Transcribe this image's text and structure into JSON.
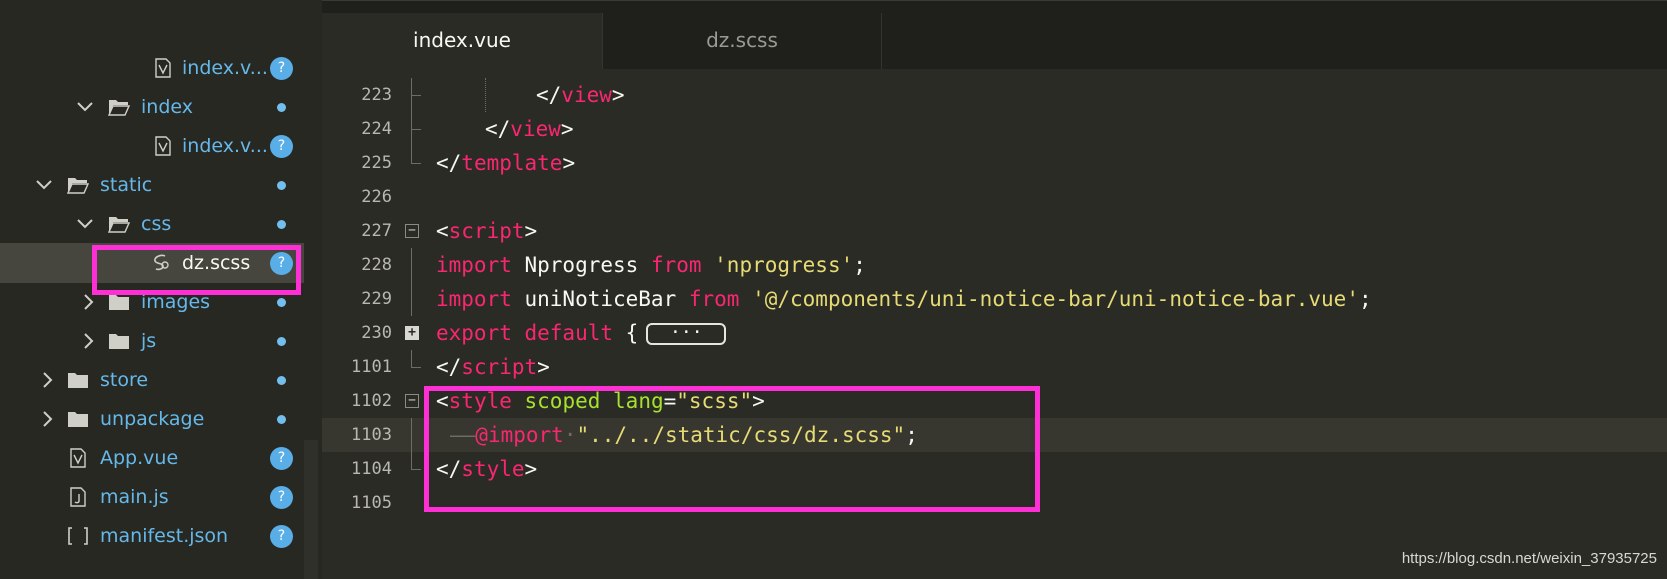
{
  "sidebar": {
    "items": [
      {
        "label": "index.v...",
        "icon": "vue-file-icon",
        "badge": "?",
        "indicator": "question"
      },
      {
        "label": "index",
        "icon": "folder-open-icon",
        "indicator": "dot",
        "chevron": "down"
      },
      {
        "label": "index.v...",
        "icon": "vue-file-icon",
        "badge": "?",
        "indicator": "question"
      },
      {
        "label": "static",
        "icon": "folder-open-icon",
        "indicator": "dot",
        "chevron": "down"
      },
      {
        "label": "css",
        "icon": "folder-open-icon",
        "indicator": "dot",
        "chevron": "down"
      },
      {
        "label": "dz.scss",
        "icon": "scss-file-icon",
        "badge": "?",
        "indicator": "question",
        "selected": true
      },
      {
        "label": "images",
        "icon": "folder-icon",
        "indicator": "dot",
        "chevron": "right"
      },
      {
        "label": "js",
        "icon": "folder-icon",
        "indicator": "dot",
        "chevron": "right"
      },
      {
        "label": "store",
        "icon": "folder-icon",
        "indicator": "dot",
        "chevron": "right"
      },
      {
        "label": "unpackage",
        "icon": "folder-icon",
        "indicator": "dot",
        "chevron": "right"
      },
      {
        "label": "App.vue",
        "icon": "vue-file-icon",
        "badge": "?",
        "indicator": "question"
      },
      {
        "label": "main.js",
        "icon": "js-file-icon",
        "badge": "?",
        "indicator": "question"
      },
      {
        "label": "manifest.json",
        "icon": "json-file-icon",
        "badge": "?",
        "indicator": "question"
      }
    ]
  },
  "tabs": [
    {
      "label": "index.vue",
      "active": true
    },
    {
      "label": "dz.scss",
      "active": false
    }
  ],
  "code": {
    "lines": [
      {
        "num": "223"
      },
      {
        "num": "224"
      },
      {
        "num": "225"
      },
      {
        "num": "226"
      },
      {
        "num": "227"
      },
      {
        "num": "228"
      },
      {
        "num": "229"
      },
      {
        "num": "230"
      },
      {
        "num": "1101"
      },
      {
        "num": "1102"
      },
      {
        "num": "1103"
      },
      {
        "num": "1104"
      },
      {
        "num": "1105"
      }
    ],
    "tokens": {
      "l223_close": "</",
      "l223_tag": "view",
      "l223_end": ">",
      "l224_close": "</",
      "l224_tag": "view",
      "l224_end": ">",
      "l225_close": "</",
      "l225_tag": "template",
      "l225_end": ">",
      "l227_open": "<",
      "l227_tag": "script",
      "l227_end": ">",
      "l228_kw": "import",
      "l228_name": " Nprogress ",
      "l228_from": "from",
      "l228_str": " 'nprogress'",
      "l228_semi": ";",
      "l229_kw": "import",
      "l229_name": " uniNoticeBar ",
      "l229_from": "from",
      "l229_str": " '@/components/uni-notice-bar/uni-notice-bar.vue'",
      "l229_semi": ";",
      "l230_kw": "export default",
      "l230_brace": " {",
      "l230_collapsed": "···",
      "l1101_close": "</",
      "l1101_tag": "script",
      "l1101_end": ">",
      "l1102_open": "<",
      "l1102_tag": "style",
      "l1102_attr1": " scoped",
      "l1102_attr2": " lang",
      "l1102_eq": "=",
      "l1102_str": "\"scss\"",
      "l1102_end": ">",
      "l1103_ws": "——",
      "l1103_kw": "@import",
      "l1103_dot": "·",
      "l1103_str": "\"../../static/css/dz.scss\"",
      "l1103_semi": ";",
      "l1104_close": "</",
      "l1104_tag": "style",
      "l1104_end": ">"
    }
  },
  "watermark": "https://blog.csdn.net/weixin_37935725",
  "colors": {
    "highlight": "#ff2fd6",
    "tag": "#f92672",
    "string": "#e6db74",
    "attribute": "#a6e22e",
    "sidebar_label": "#66b8ea"
  }
}
